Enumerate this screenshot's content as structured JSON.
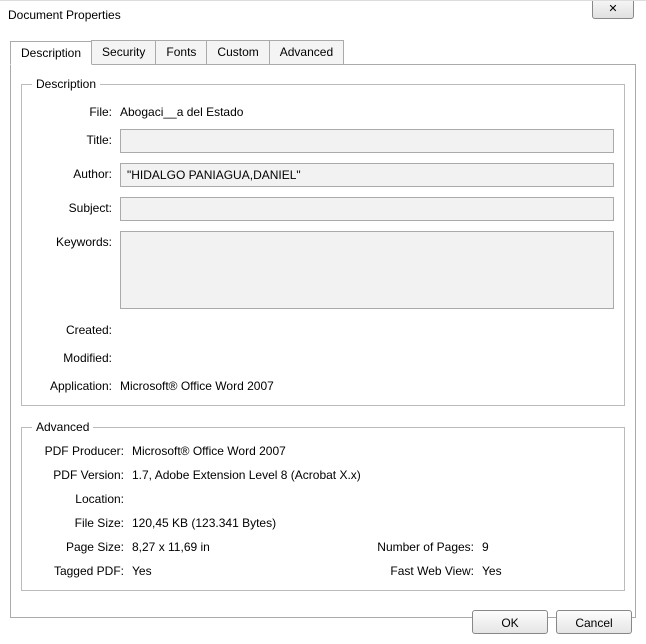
{
  "window": {
    "title": "Document Properties",
    "close": "✕"
  },
  "tabs": {
    "description": "Description",
    "security": "Security",
    "fonts": "Fonts",
    "custom": "Custom",
    "advanced": "Advanced"
  },
  "description": {
    "legend": "Description",
    "labels": {
      "file": "File:",
      "title": "Title:",
      "author": "Author:",
      "subject": "Subject:",
      "keywords": "Keywords:",
      "created": "Created:",
      "modified": "Modified:",
      "application": "Application:"
    },
    "values": {
      "file": "Abogaci__a del Estado",
      "title": "",
      "author": "\"HIDALGO PANIAGUA,DANIEL\"",
      "subject": "",
      "keywords": "",
      "created": "",
      "modified": "",
      "application": "Microsoft® Office Word 2007"
    }
  },
  "advanced": {
    "legend": "Advanced",
    "labels": {
      "producer": "PDF Producer:",
      "version": "PDF Version:",
      "location": "Location:",
      "filesize": "File Size:",
      "pagesize": "Page Size:",
      "numpages": "Number of Pages:",
      "tagged": "Tagged PDF:",
      "fastweb": "Fast Web View:"
    },
    "values": {
      "producer": "Microsoft® Office Word 2007",
      "version": "1.7, Adobe Extension Level 8 (Acrobat X.x)",
      "location": "",
      "filesize": "120,45 KB (123.341 Bytes)",
      "pagesize": "8,27 x 11,69 in",
      "numpages": "9",
      "tagged": "Yes",
      "fastweb": "Yes"
    }
  },
  "footer": {
    "ok": "OK",
    "cancel": "Cancel"
  }
}
